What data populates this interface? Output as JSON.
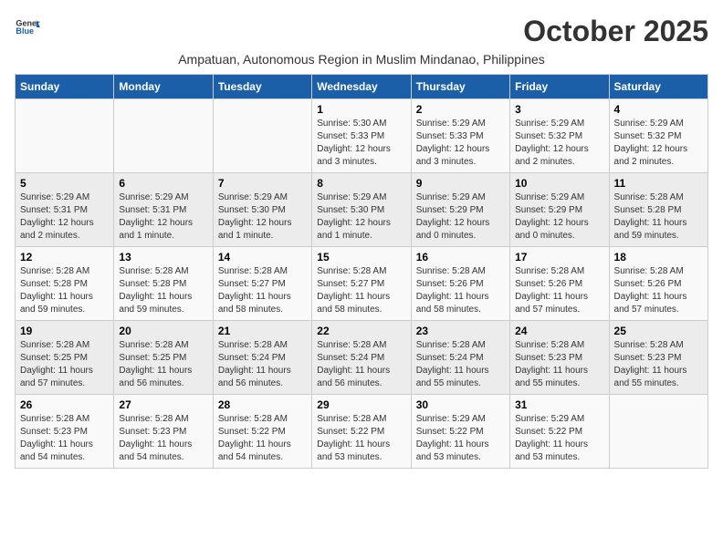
{
  "header": {
    "logo_line1": "General",
    "logo_line2": "Blue",
    "month_title": "October 2025",
    "subtitle": "Ampatuan, Autonomous Region in Muslim Mindanao, Philippines"
  },
  "days_of_week": [
    "Sunday",
    "Monday",
    "Tuesday",
    "Wednesday",
    "Thursday",
    "Friday",
    "Saturday"
  ],
  "weeks": [
    [
      {
        "day": "",
        "info": ""
      },
      {
        "day": "",
        "info": ""
      },
      {
        "day": "",
        "info": ""
      },
      {
        "day": "1",
        "info": "Sunrise: 5:30 AM\nSunset: 5:33 PM\nDaylight: 12 hours\nand 3 minutes."
      },
      {
        "day": "2",
        "info": "Sunrise: 5:29 AM\nSunset: 5:33 PM\nDaylight: 12 hours\nand 3 minutes."
      },
      {
        "day": "3",
        "info": "Sunrise: 5:29 AM\nSunset: 5:32 PM\nDaylight: 12 hours\nand 2 minutes."
      },
      {
        "day": "4",
        "info": "Sunrise: 5:29 AM\nSunset: 5:32 PM\nDaylight: 12 hours\nand 2 minutes."
      }
    ],
    [
      {
        "day": "5",
        "info": "Sunrise: 5:29 AM\nSunset: 5:31 PM\nDaylight: 12 hours\nand 2 minutes."
      },
      {
        "day": "6",
        "info": "Sunrise: 5:29 AM\nSunset: 5:31 PM\nDaylight: 12 hours\nand 1 minute."
      },
      {
        "day": "7",
        "info": "Sunrise: 5:29 AM\nSunset: 5:30 PM\nDaylight: 12 hours\nand 1 minute."
      },
      {
        "day": "8",
        "info": "Sunrise: 5:29 AM\nSunset: 5:30 PM\nDaylight: 12 hours\nand 1 minute."
      },
      {
        "day": "9",
        "info": "Sunrise: 5:29 AM\nSunset: 5:29 PM\nDaylight: 12 hours\nand 0 minutes."
      },
      {
        "day": "10",
        "info": "Sunrise: 5:29 AM\nSunset: 5:29 PM\nDaylight: 12 hours\nand 0 minutes."
      },
      {
        "day": "11",
        "info": "Sunrise: 5:28 AM\nSunset: 5:28 PM\nDaylight: 11 hours\nand 59 minutes."
      }
    ],
    [
      {
        "day": "12",
        "info": "Sunrise: 5:28 AM\nSunset: 5:28 PM\nDaylight: 11 hours\nand 59 minutes."
      },
      {
        "day": "13",
        "info": "Sunrise: 5:28 AM\nSunset: 5:28 PM\nDaylight: 11 hours\nand 59 minutes."
      },
      {
        "day": "14",
        "info": "Sunrise: 5:28 AM\nSunset: 5:27 PM\nDaylight: 11 hours\nand 58 minutes."
      },
      {
        "day": "15",
        "info": "Sunrise: 5:28 AM\nSunset: 5:27 PM\nDaylight: 11 hours\nand 58 minutes."
      },
      {
        "day": "16",
        "info": "Sunrise: 5:28 AM\nSunset: 5:26 PM\nDaylight: 11 hours\nand 58 minutes."
      },
      {
        "day": "17",
        "info": "Sunrise: 5:28 AM\nSunset: 5:26 PM\nDaylight: 11 hours\nand 57 minutes."
      },
      {
        "day": "18",
        "info": "Sunrise: 5:28 AM\nSunset: 5:26 PM\nDaylight: 11 hours\nand 57 minutes."
      }
    ],
    [
      {
        "day": "19",
        "info": "Sunrise: 5:28 AM\nSunset: 5:25 PM\nDaylight: 11 hours\nand 57 minutes."
      },
      {
        "day": "20",
        "info": "Sunrise: 5:28 AM\nSunset: 5:25 PM\nDaylight: 11 hours\nand 56 minutes."
      },
      {
        "day": "21",
        "info": "Sunrise: 5:28 AM\nSunset: 5:24 PM\nDaylight: 11 hours\nand 56 minutes."
      },
      {
        "day": "22",
        "info": "Sunrise: 5:28 AM\nSunset: 5:24 PM\nDaylight: 11 hours\nand 56 minutes."
      },
      {
        "day": "23",
        "info": "Sunrise: 5:28 AM\nSunset: 5:24 PM\nDaylight: 11 hours\nand 55 minutes."
      },
      {
        "day": "24",
        "info": "Sunrise: 5:28 AM\nSunset: 5:23 PM\nDaylight: 11 hours\nand 55 minutes."
      },
      {
        "day": "25",
        "info": "Sunrise: 5:28 AM\nSunset: 5:23 PM\nDaylight: 11 hours\nand 55 minutes."
      }
    ],
    [
      {
        "day": "26",
        "info": "Sunrise: 5:28 AM\nSunset: 5:23 PM\nDaylight: 11 hours\nand 54 minutes."
      },
      {
        "day": "27",
        "info": "Sunrise: 5:28 AM\nSunset: 5:23 PM\nDaylight: 11 hours\nand 54 minutes."
      },
      {
        "day": "28",
        "info": "Sunrise: 5:28 AM\nSunset: 5:22 PM\nDaylight: 11 hours\nand 54 minutes."
      },
      {
        "day": "29",
        "info": "Sunrise: 5:28 AM\nSunset: 5:22 PM\nDaylight: 11 hours\nand 53 minutes."
      },
      {
        "day": "30",
        "info": "Sunrise: 5:29 AM\nSunset: 5:22 PM\nDaylight: 11 hours\nand 53 minutes."
      },
      {
        "day": "31",
        "info": "Sunrise: 5:29 AM\nSunset: 5:22 PM\nDaylight: 11 hours\nand 53 minutes."
      },
      {
        "day": "",
        "info": ""
      }
    ]
  ]
}
